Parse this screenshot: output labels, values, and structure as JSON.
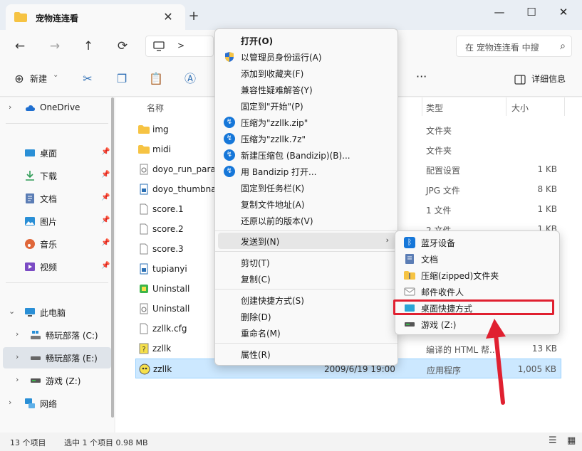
{
  "window": {
    "tab_title": "宠物连连看",
    "controls": [
      "—",
      "☐",
      "✕"
    ]
  },
  "nav": {
    "search_placeholder": "在 宠物连连看 中搜",
    "addr_chevron": ">"
  },
  "toolbar": {
    "new_label": "新建",
    "details_label": "详细信息"
  },
  "sidebar": {
    "items": [
      {
        "label": "OneDrive"
      },
      {
        "label": "桌面"
      },
      {
        "label": "下载"
      },
      {
        "label": "文档"
      },
      {
        "label": "图片"
      },
      {
        "label": "音乐"
      },
      {
        "label": "视频"
      },
      {
        "label": "此电脑"
      },
      {
        "label": "畅玩部落 (C:)"
      },
      {
        "label": "畅玩部落 (E:)"
      },
      {
        "label": "游戏 (Z:)"
      },
      {
        "label": "网络"
      }
    ]
  },
  "columns": {
    "name": "名称",
    "type": "类型",
    "size": "大小"
  },
  "files": [
    {
      "name": "img",
      "date": "",
      "type": "文件夹",
      "size": ""
    },
    {
      "name": "midi",
      "date": "",
      "type": "文件夹",
      "size": ""
    },
    {
      "name": "doyo_run_para",
      "date": "",
      "type": "配置设置",
      "size": "1 KB"
    },
    {
      "name": "doyo_thumbna",
      "date": "",
      "type": "JPG 文件",
      "size": "8 KB"
    },
    {
      "name": "score.1",
      "date": "",
      "type": "1 文件",
      "size": "1 KB"
    },
    {
      "name": "score.2",
      "date": "",
      "type": "2 文件",
      "size": "1 KB"
    },
    {
      "name": "score.3",
      "date": "",
      "type": "",
      "size": ""
    },
    {
      "name": "tupianyi",
      "date": "",
      "type": "",
      "size": ""
    },
    {
      "name": "Uninstall",
      "date": "",
      "type": "",
      "size": ""
    },
    {
      "name": "Uninstall",
      "date": "",
      "type": "",
      "size": ""
    },
    {
      "name": "zzllk.cfg",
      "date": "",
      "type": "",
      "size": ""
    },
    {
      "name": "zzllk",
      "date": "",
      "type": "编译的 HTML 帮...",
      "size": "13 KB"
    },
    {
      "name": "zzllk",
      "date": "2009/6/19 19:00",
      "type": "应用程序",
      "size": "1,005 KB"
    }
  ],
  "context_menu": {
    "items": [
      {
        "label": "打开(O)"
      },
      {
        "label": "以管理员身份运行(A)"
      },
      {
        "label": "添加到收藏夹(F)"
      },
      {
        "label": "兼容性疑难解答(Y)"
      },
      {
        "label": "固定到\"开始\"(P)"
      },
      {
        "label": "压缩为\"zzllk.zip\""
      },
      {
        "label": "压缩为\"zzllk.7z\""
      },
      {
        "label": "新建压缩包 (Bandizip)(B)..."
      },
      {
        "label": "用 Bandizip 打开..."
      },
      {
        "label": "固定到任务栏(K)"
      },
      {
        "label": "复制文件地址(A)"
      },
      {
        "label": "还原以前的版本(V)"
      },
      {
        "label": "发送到(N)"
      },
      {
        "label": "剪切(T)"
      },
      {
        "label": "复制(C)"
      },
      {
        "label": "创建快捷方式(S)"
      },
      {
        "label": "删除(D)"
      },
      {
        "label": "重命名(M)"
      },
      {
        "label": "属性(R)"
      }
    ]
  },
  "send_to_menu": {
    "items": [
      {
        "label": "蓝牙设备"
      },
      {
        "label": "文档"
      },
      {
        "label": "压缩(zipped)文件夹"
      },
      {
        "label": "邮件收件人"
      },
      {
        "label": "桌面快捷方式"
      },
      {
        "label": "游戏 (Z:)"
      }
    ]
  },
  "status": {
    "count": "13 个项目",
    "selection": "选中 1 个项目  0.98 MB"
  },
  "colors": {
    "highlight": "#e02030",
    "accent": "#0067c0"
  }
}
